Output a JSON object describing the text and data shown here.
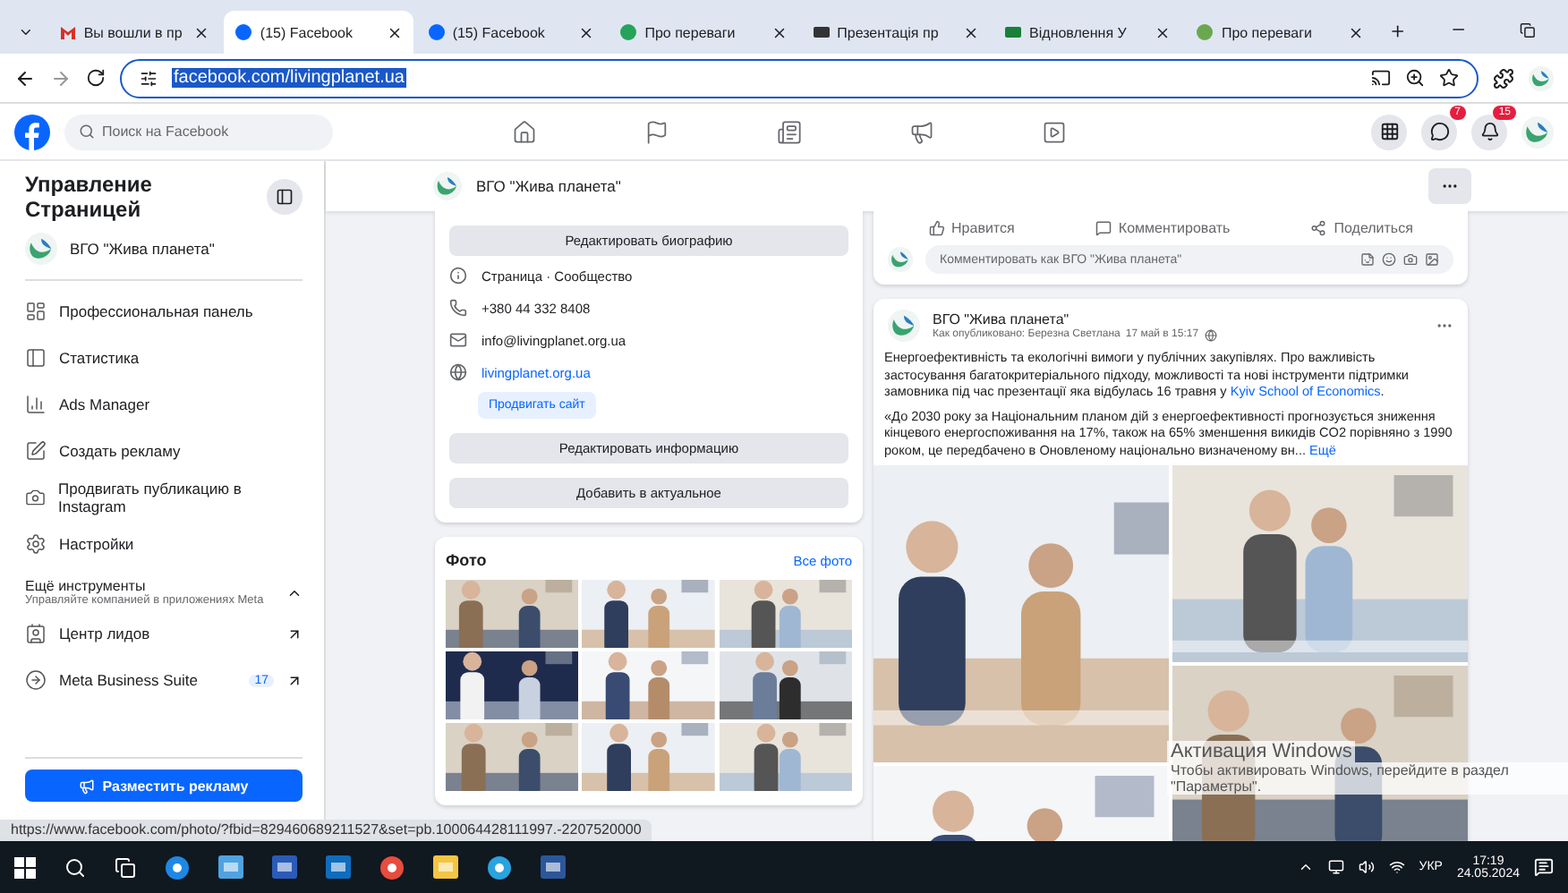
{
  "browser": {
    "tabs": [
      {
        "title": "Вы вошли в пр",
        "selected": false
      },
      {
        "title": "(15) Facebook",
        "selected": true
      },
      {
        "title": "(15) Facebook",
        "selected": false
      },
      {
        "title": "Про переваги",
        "selected": false
      },
      {
        "title": "Презентація пр",
        "selected": false
      },
      {
        "title": "Відновлення У",
        "selected": false
      },
      {
        "title": "Про переваги",
        "selected": false
      }
    ],
    "address": "facebook.com/livingplanet.ua"
  },
  "header": {
    "search_placeholder": "Поиск на Facebook",
    "nav": [
      {
        "kind": "home"
      },
      {
        "kind": "flag"
      },
      {
        "kind": "news"
      },
      {
        "kind": "megaphone"
      },
      {
        "kind": "video"
      }
    ],
    "messenger_badge": "7",
    "notifications_badge": "15"
  },
  "sidebar": {
    "title": "Управление Страницей",
    "page_name": "ВГО \"Жива планета\"",
    "items": [
      {
        "label": "Профессиональная панель"
      },
      {
        "label": "Статистика"
      },
      {
        "label": "Ads Manager"
      },
      {
        "label": "Создать рекламу"
      },
      {
        "label": "Продвигать публикацию в Instagram"
      },
      {
        "label": "Настройки"
      }
    ],
    "more_tools": {
      "title": "Ещё инструменты",
      "subtitle": "Управляйте компанией в приложениях Meta",
      "expanded": true,
      "items": [
        {
          "label": "Центр лидов"
        },
        {
          "label": "Meta Business Suite",
          "badge": "17"
        }
      ]
    },
    "ad_button": "Разместить рекламу"
  },
  "page_header": {
    "name": "ВГО \"Жива планета\""
  },
  "intro": {
    "edit_bio": "Редактировать биографию",
    "details": [
      {
        "kind": "info",
        "text": "Страница · Сообщество"
      },
      {
        "kind": "phone",
        "text": "+380 44 332 8408"
      },
      {
        "kind": "email",
        "text": "info@livingplanet.org.ua"
      },
      {
        "kind": "website",
        "text": "livingplanet.org.ua",
        "action": "Продвигать сайт"
      }
    ],
    "buttons": [
      "Редактировать информацию",
      "Добавить в актуальное"
    ]
  },
  "photos": {
    "title": "Фото",
    "link": "Все фото"
  },
  "post_actions": {
    "buttons": [
      "Нравится",
      "Комментировать",
      "Поделиться"
    ],
    "comment_placeholder": "Комментировать как ВГО \"Жива планета\""
  },
  "post": {
    "author": "ВГО \"Жива планета\"",
    "byline": "Как опубликовано: Березна Светлана",
    "time": "17 май в 15:17",
    "paragraphs": [
      {
        "text": "Енергоефективність та екологічні вимоги у публічних закупівлях. Про важливість застосування багатокритеріального підходу, можливості та нові інструменти підтримки замовника під час презентації яка відбулась 16 травня у ",
        "link": "Kyiv School of Economics",
        "after": "."
      },
      {
        "text": "«До 2030 року за Національним планом дій з енергоефективності прогнозується зниження кінцевого енергоспоживання на 17%, також на 65% зменшення викидів CO2 порівняно з 1990 роком, це передбачено в Оновленому національно визначеному вн... ",
        "link": "Ещё"
      }
    ]
  },
  "status_url": "https://www.facebook.com/photo/?fbid=829460689211527&set=pb.100064428111997.-2207520000",
  "activation": {
    "title": "Активация Windows",
    "text": "Чтобы активировать Windows, перейдите в раздел \"Параметры\"."
  },
  "taskbar": {
    "apps": [
      {
        "kind": "start"
      },
      {
        "kind": "search"
      },
      {
        "kind": "taskview"
      },
      {
        "kind": "edge"
      },
      {
        "kind": "store"
      },
      {
        "kind": "terminal"
      },
      {
        "kind": "mail"
      },
      {
        "kind": "chrome"
      },
      {
        "kind": "folder"
      },
      {
        "kind": "telegram"
      },
      {
        "kind": "doc"
      }
    ],
    "language": "УКР",
    "time": "17:19",
    "date": "24.05.2024"
  }
}
